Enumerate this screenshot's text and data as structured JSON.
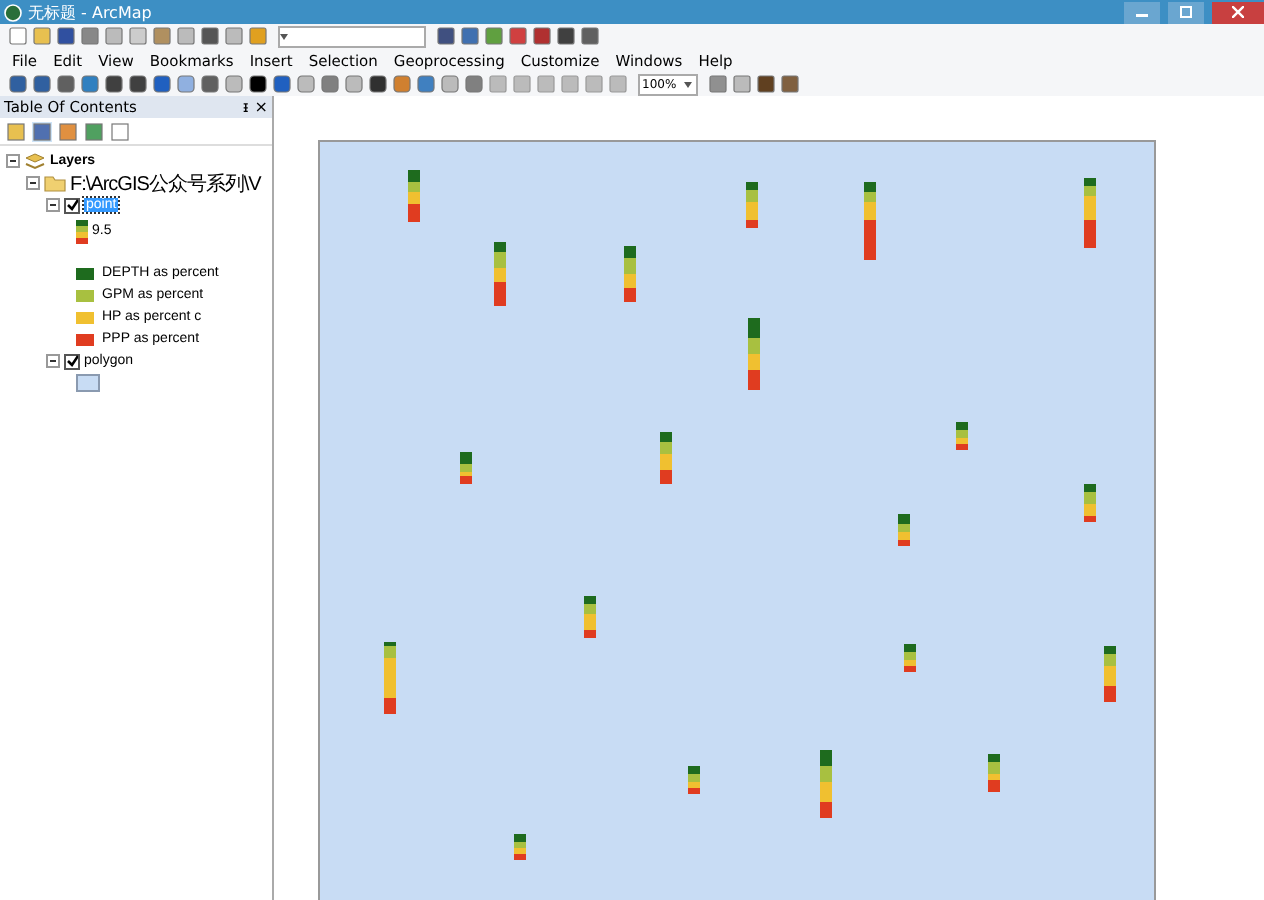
{
  "window": {
    "title": "无标题 - ArcMap"
  },
  "menu": [
    "File",
    "Edit",
    "View",
    "Bookmarks",
    "Insert",
    "Selection",
    "Geoprocessing",
    "Customize",
    "Windows",
    "Help"
  ],
  "layout_toolbar": {
    "zoom": "100%"
  },
  "toc": {
    "title": "Table Of Contents",
    "pin": "ᵻ",
    "close": "×",
    "tree": [
      {
        "label": "Layers",
        "expanded": true,
        "children": [
          {
            "label": "F:\\ArcGIS公众号系列\\V",
            "expanded": true,
            "children": [
              {
                "label": "point",
                "expanded": true,
                "checked": true,
                "selected": true,
                "symbol_label": "9.5",
                "legend": [
                  {
                    "label": "DEPTH as percent",
                    "color": "#1e6b1e"
                  },
                  {
                    "label": "GPM as percent",
                    "color": "#a8c040"
                  },
                  {
                    "label": "HP as percent c",
                    "color": "#f0c030"
                  },
                  {
                    "label": "PPP as percent",
                    "color": "#e03c20"
                  }
                ]
              },
              {
                "label": "polygon",
                "expanded": true,
                "checked": true,
                "selected": false
              }
            ]
          }
        ]
      }
    ]
  }
}
